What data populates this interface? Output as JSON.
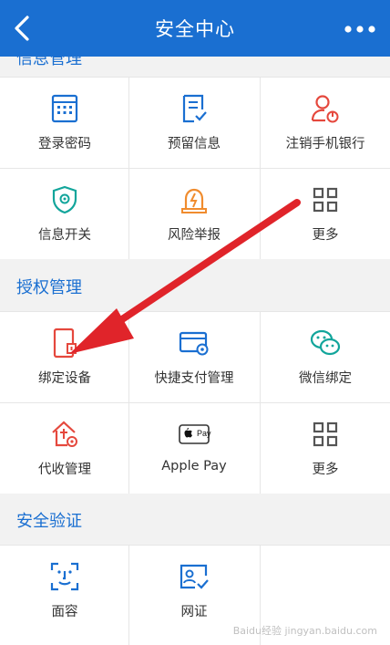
{
  "header": {
    "title": "安全中心"
  },
  "sections": [
    {
      "title": "信息管理",
      "items": [
        {
          "label": "登录密码",
          "icon": "keypad-icon"
        },
        {
          "label": "预留信息",
          "icon": "document-check-icon"
        },
        {
          "label": "注销手机银行",
          "icon": "user-power-icon"
        },
        {
          "label": "信息开关",
          "icon": "shield-gear-icon"
        },
        {
          "label": "风险举报",
          "icon": "alarm-light-icon"
        },
        {
          "label": "更多",
          "icon": "grid-icon"
        }
      ]
    },
    {
      "title": "授权管理",
      "items": [
        {
          "label": "绑定设备",
          "icon": "device-icon"
        },
        {
          "label": "快捷支付管理",
          "icon": "card-gear-icon"
        },
        {
          "label": "微信绑定",
          "icon": "wechat-icon"
        },
        {
          "label": "代收管理",
          "icon": "house-collect-icon"
        },
        {
          "label": "Apple Pay",
          "icon": "apple-pay-icon"
        },
        {
          "label": "更多",
          "icon": "grid-icon"
        }
      ]
    },
    {
      "title": "安全验证",
      "items": [
        {
          "label": "面容",
          "icon": "face-scan-icon"
        },
        {
          "label": "网证",
          "icon": "id-card-icon"
        }
      ]
    }
  ],
  "apple_pay_badge": "Pay",
  "watermark": "Baidu经验 jingyan.baidu.com",
  "colors": {
    "header": "#1a6fd1",
    "blue": "#1a6fd1",
    "red": "#e5483d",
    "orange": "#f08c2e",
    "teal": "#12a59b",
    "arrow": "#e0242a"
  }
}
